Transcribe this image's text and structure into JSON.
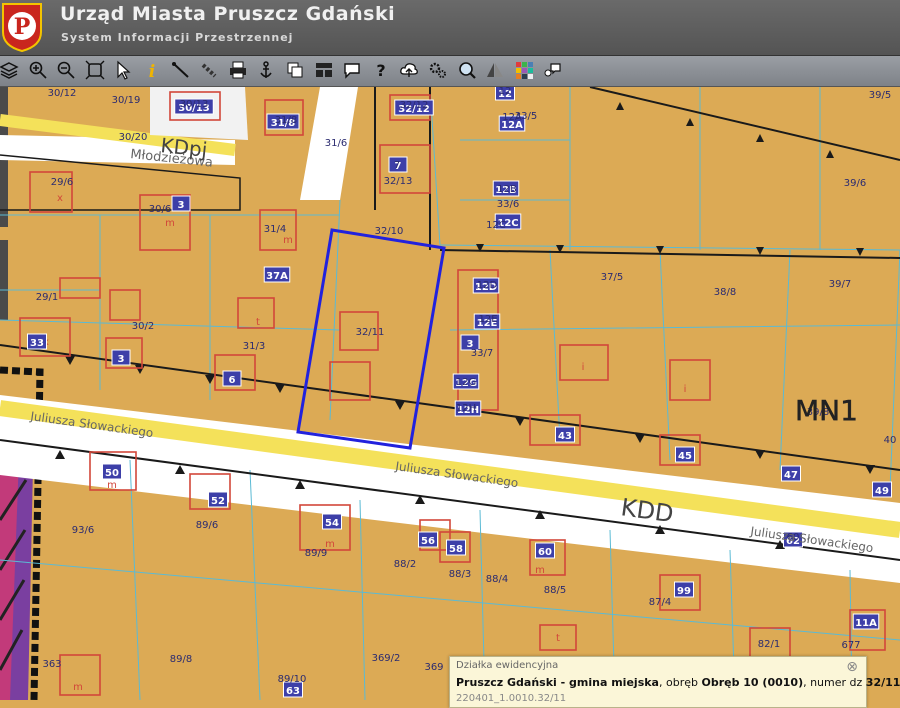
{
  "header": {
    "title": "Urząd Miasta Pruszcz Gdański",
    "subtitle": "System Informacji Przestrzennej",
    "logo_letter": "P"
  },
  "toolbar": {
    "tools": [
      "layers-icon",
      "zoom-in-icon",
      "zoom-out-icon",
      "zoom-extent-icon",
      "select-pointer-icon",
      "info-icon",
      "measure-line-icon",
      "measure-link-icon",
      "print-icon",
      "anchor-icon",
      "copy-icon",
      "layout-icon",
      "chat-icon",
      "help-icon",
      "cloud-upload-icon",
      "settings-icon",
      "search-icon",
      "terrain-icon",
      "color-grid-icon",
      "comment-icon"
    ],
    "accent": "#4a7fb5"
  },
  "map": {
    "parcel_fill": "#dcaa55",
    "road_fill": "#ffffff",
    "street_center": "#f4e15a",
    "parcel_line": "#5bbad4",
    "building_line": "#d2473a",
    "house_number_fill": "#3d3fa8",
    "selection_color": "#2222dd",
    "parcels": [
      "30/12",
      "30/19",
      "30/13",
      "31/8",
      "32/12",
      "12",
      "12A",
      "33/5",
      "39/5",
      "30/20",
      "31/6",
      "7",
      "32/13",
      "12B",
      "33/6",
      "39/6",
      "29/6",
      "30/6",
      "31/4",
      "32/10",
      "12C",
      "29/1",
      "30/2",
      "31/3",
      "32/11",
      "12D",
      "12E",
      "33/7",
      "37/5",
      "38/8",
      "39/7",
      "12G",
      "12H",
      "39/8",
      "40",
      "93/6",
      "89/6",
      "89/9",
      "88/2",
      "88/3",
      "88/4",
      "88/5",
      "87/4",
      "60",
      "363",
      "89/8",
      "89/10",
      "369/2",
      "369",
      "82/1",
      "677"
    ],
    "house_numbers": [
      "30/13",
      "31/8",
      "32/12",
      "12",
      "12A",
      "7",
      "12B",
      "12C",
      "3",
      "37A",
      "33",
      "3",
      "6",
      "12D",
      "12E",
      "3",
      "12G",
      "12H",
      "43",
      "45",
      "47",
      "49",
      "50",
      "52",
      "54",
      "56",
      "58",
      "60",
      "62",
      "99",
      "11A",
      "63"
    ],
    "land_use": [
      "MN1",
      "KDD",
      "KDpj"
    ],
    "streets": [
      "Młodzieżowa",
      "Juliusza Słowackiego",
      "Juliusza Słowackiego",
      "Juliusza Słowackiego"
    ],
    "building_letters": [
      "x",
      "m",
      "t",
      "i"
    ]
  },
  "info": {
    "caption": "Działka ewidencyjna",
    "place": "Pruszcz Gdański - gmina miejska",
    "mid1": ", obręb ",
    "obreb": "Obręb 10 (0010)",
    "mid2": ", numer dz ",
    "number": "32/11",
    "id": "220401_1.0010.32/11",
    "close": "⊗"
  }
}
